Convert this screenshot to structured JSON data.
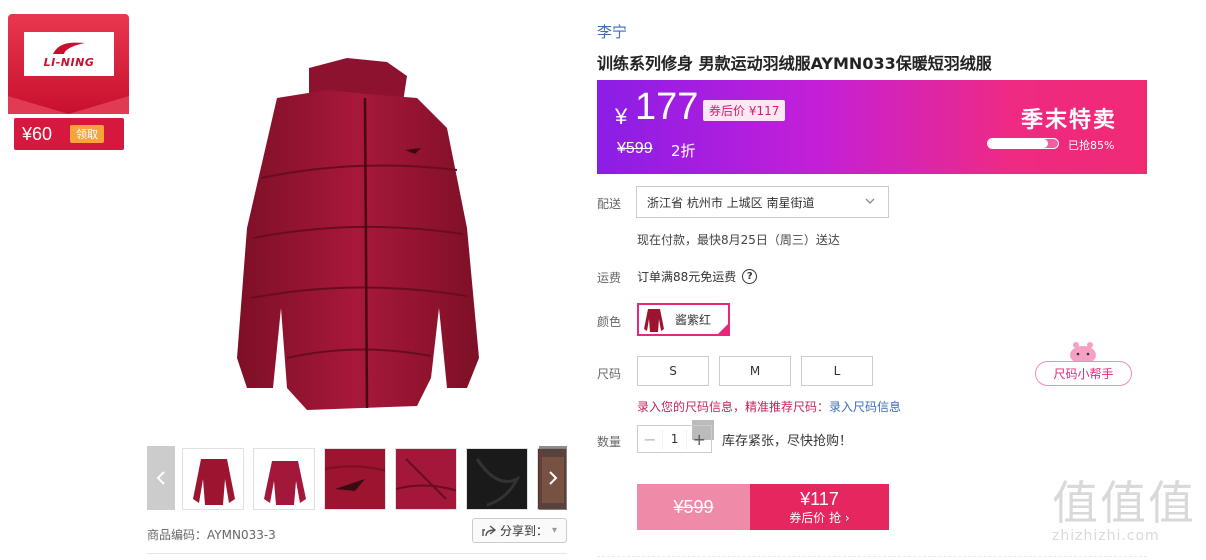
{
  "brand_badge": {
    "logo_text": "LI-NING",
    "coupon_amount": "¥60",
    "coupon_claim": "领取"
  },
  "gallery": {
    "thumbnail_count": 6,
    "sku_code": "商品编码：AYMN033-3",
    "share_label": "分享到：",
    "share_caret": "▾"
  },
  "product": {
    "brand": "李宁",
    "title": "训练系列修身 男款运动羽绒服AYMN033保暖短羽绒服"
  },
  "price_banner": {
    "currency": "¥",
    "price": "177",
    "after_coupon": "券后价 ¥117",
    "original_price": "¥599",
    "discount": "2折",
    "sale_title": "季末特卖",
    "progress_percent": 85,
    "progress_label": "已抢85%"
  },
  "delivery": {
    "label": "配送",
    "address": "浙江省 杭州市 上城区 南星街道",
    "note": "现在付款，最快8月25日（周三）送达"
  },
  "shipping": {
    "label": "运费",
    "text": "订单满88元免运费",
    "help": "?"
  },
  "color": {
    "label": "颜色",
    "selected": "酱紫红"
  },
  "size": {
    "label": "尺码",
    "options": [
      "S",
      "M",
      "L"
    ],
    "helper": "尺码小帮手",
    "tip_prefix": "录入您的尺码信息，精准推荐尺码：",
    "tip_link": "录入尺码信息"
  },
  "quantity": {
    "label": "数量",
    "minus": "−",
    "value": "1",
    "plus": "+",
    "stock_note": "库存紧张，尽快抢购！"
  },
  "buy": {
    "original_price": "¥599",
    "coupon_price": "¥117",
    "coupon_label": "券后价 抢 ›"
  },
  "watermark": {
    "glyphs": "值值值",
    "url": "zhizhizhi.com"
  },
  "colors": {
    "accent": "#e6275f",
    "brand_red": "#c8102e",
    "link_blue": "#3b6db4",
    "jacket": "#9c1430"
  }
}
